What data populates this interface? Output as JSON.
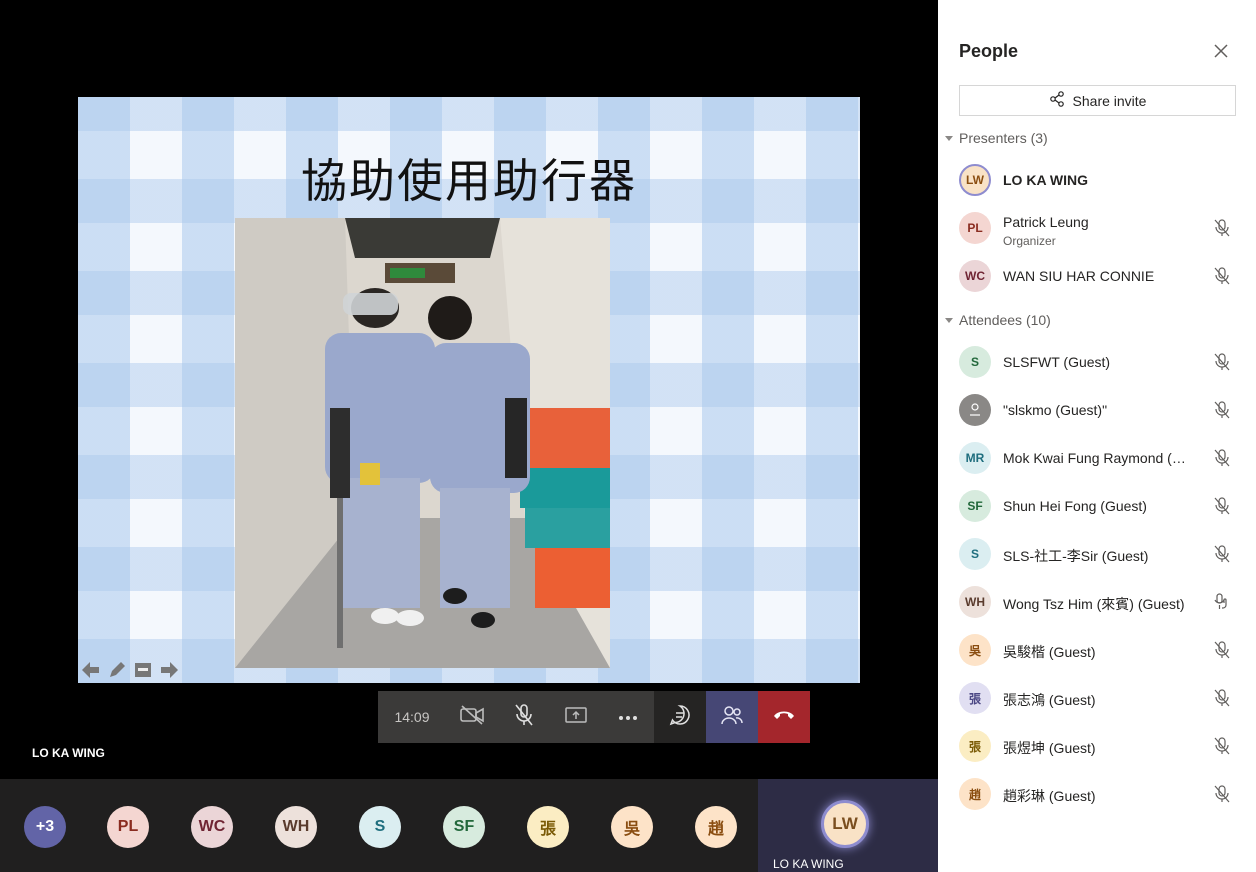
{
  "slide": {
    "title": "協助使用助行器"
  },
  "controls": {
    "call_time": "14:09",
    "video_icon": "camera-off-icon",
    "mic_icon": "mic-off-icon",
    "share_icon": "share-screen-icon",
    "more_icon": "more-icon",
    "chat_icon": "chat-icon",
    "people_icon": "people-icon",
    "hangup_icon": "hangup-icon"
  },
  "speaker": {
    "name": "LO KA WING"
  },
  "strip": {
    "items": [
      {
        "initials": "+3",
        "bg": "#6264a7",
        "fg": "#ffffff"
      },
      {
        "initials": "PL",
        "bg": "#f4d6d1",
        "fg": "#8a2c20"
      },
      {
        "initials": "WC",
        "bg": "#ebd5d7",
        "fg": "#6f2433"
      },
      {
        "initials": "WH",
        "bg": "#ede1db",
        "fg": "#5a3b2d"
      },
      {
        "initials": "S",
        "bg": "#dbeef1",
        "fg": "#1f6e7e"
      },
      {
        "initials": "SF",
        "bg": "#d7ebde",
        "fg": "#22683b"
      },
      {
        "initials": "張",
        "bg": "#fbedc3",
        "fg": "#7a5a05"
      },
      {
        "initials": "吳",
        "bg": "#fde3c8",
        "fg": "#8a4d10"
      },
      {
        "initials": "趙",
        "bg": "#fde3c8",
        "fg": "#8a4d10"
      }
    ],
    "self": {
      "initials": "LW",
      "name": "LO KA WING"
    }
  },
  "panel": {
    "title": "People",
    "share_label": "Share invite",
    "presenters_label": "Presenters (3)",
    "attendees_label": "Attendees (10)",
    "presenters": [
      {
        "initials": "LW",
        "name": "LO KA WING",
        "bold": true,
        "bg": "#f9e2c6",
        "fg": "#8a4d10",
        "ring": true,
        "mic": ""
      },
      {
        "initials": "PL",
        "name": "Patrick Leung",
        "sub": "Organizer",
        "bg": "#f4d6d1",
        "fg": "#8a2c20",
        "mic": "mic-off-icon"
      },
      {
        "initials": "WC",
        "name": "WAN SIU HAR CONNIE",
        "bg": "#ebd5d7",
        "fg": "#6f2433",
        "mic": "mic-off-icon"
      }
    ],
    "attendees": [
      {
        "initials": "S",
        "name": "SLSFWT (Guest)",
        "bg": "#d7ebde",
        "fg": "#22683b",
        "mic": "mic-off-icon"
      },
      {
        "initials": "",
        "name": "\"slskmo (Guest)\"",
        "bg": "#8a8886",
        "fg": "#ffffff",
        "mic": "mic-off-icon",
        "icon": "user-icon"
      },
      {
        "initials": "MR",
        "name": "Mok Kwai Fung Raymond (G...",
        "bg": "#dbeef1",
        "fg": "#1f6e7e",
        "mic": "mic-off-icon"
      },
      {
        "initials": "SF",
        "name": "Shun Hei Fong (Guest)",
        "bg": "#d7ebde",
        "fg": "#22683b",
        "mic": "mic-off-icon"
      },
      {
        "initials": "S",
        "name": "SLS-社工-李Sir (Guest)",
        "bg": "#dbeef1",
        "fg": "#1f6e7e",
        "mic": "mic-off-icon"
      },
      {
        "initials": "WH",
        "name": "Wong Tsz Him (來賓) (Guest)",
        "bg": "#ede1db",
        "fg": "#5a3b2d",
        "mic": "mic-hand-icon"
      },
      {
        "initials": "吳",
        "name": "吳駿楷 (Guest)",
        "bg": "#fde3c8",
        "fg": "#8a4d10",
        "mic": "mic-off-icon"
      },
      {
        "initials": "張",
        "name": "張志鴻 (Guest)",
        "bg": "#e1dff2",
        "fg": "#4b4785",
        "mic": "mic-off-icon"
      },
      {
        "initials": "張",
        "name": "張煜坤 (Guest)",
        "bg": "#fbedc3",
        "fg": "#7a5a05",
        "mic": "mic-off-icon"
      },
      {
        "initials": "趙",
        "name": "趙彩琳 (Guest)",
        "bg": "#fde3c8",
        "fg": "#8a4d10",
        "mic": "mic-off-icon"
      }
    ]
  }
}
